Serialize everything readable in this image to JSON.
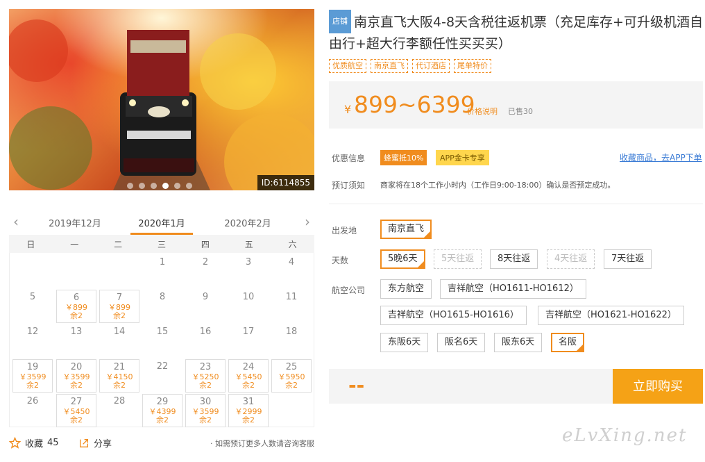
{
  "hero": {
    "id_label": "ID:6114855",
    "slide_count": 6,
    "active_slide": 4
  },
  "calendar": {
    "months": [
      "2019年12月",
      "2020年1月",
      "2020年2月"
    ],
    "weekdays": [
      "日",
      "一",
      "二",
      "三",
      "四",
      "五",
      "六"
    ],
    "days": [
      {
        "d": "1"
      },
      {
        "d": "2"
      },
      {
        "d": "3"
      },
      {
        "d": "4"
      },
      {
        "d": "5"
      },
      {
        "d": "6",
        "price": "￥899",
        "stock": "余2"
      },
      {
        "d": "7",
        "price": "￥899",
        "stock": "余2"
      },
      {
        "d": "8"
      },
      {
        "d": "9"
      },
      {
        "d": "10"
      },
      {
        "d": "11"
      },
      {
        "d": "12"
      },
      {
        "d": "13"
      },
      {
        "d": "14"
      },
      {
        "d": "15"
      },
      {
        "d": "16"
      },
      {
        "d": "17"
      },
      {
        "d": "18"
      },
      {
        "d": "19",
        "price": "￥3599",
        "stock": "余2"
      },
      {
        "d": "20",
        "price": "￥3599",
        "stock": "余2"
      },
      {
        "d": "21",
        "price": "￥4150",
        "stock": "余2"
      },
      {
        "d": "22"
      },
      {
        "d": "23",
        "price": "￥5250",
        "stock": "余2"
      },
      {
        "d": "24",
        "price": "￥5450",
        "stock": "余2"
      },
      {
        "d": "25",
        "price": "￥5950",
        "stock": "余2"
      },
      {
        "d": "26"
      },
      {
        "d": "27",
        "price": "￥5450",
        "stock": "余2"
      },
      {
        "d": "28"
      },
      {
        "d": "29",
        "price": "￥4399",
        "stock": "余2"
      },
      {
        "d": "30",
        "price": "￥3599",
        "stock": "余2"
      },
      {
        "d": "31",
        "price": "￥2999",
        "stock": "余2"
      }
    ]
  },
  "footer": {
    "favorite_label": "收藏",
    "favorite_count": "45",
    "share_label": "分享",
    "tip": "· 如需预订更多人数请咨询客服"
  },
  "product": {
    "shop_badge": "店铺",
    "title": "南京直飞大阪4-8天含税往返机票（充足库存+可升级机酒自由行+超大行李额任性买买买）",
    "tags": [
      "优质航空",
      "南京直飞",
      "代订酒店",
      "尾单特价"
    ],
    "currency": "¥",
    "price": "899~6399",
    "price_note": "价格说明",
    "sold": "已售30"
  },
  "info": {
    "promo_label": "优惠信息",
    "promo_tags": [
      "蜂蜜抵10%",
      "APP金卡专享"
    ],
    "app_link": "收藏商品，去APP下单",
    "notice_label": "预订须知",
    "notice_text": "商家将在18个工作小时内（工作日9:00-18:00）确认是否预定成功。"
  },
  "options": {
    "departure_label": "出发地",
    "departure": [
      "南京直飞"
    ],
    "days_label": "天数",
    "days": [
      "5晚6天",
      "5天往返",
      "8天往返",
      "4天往返",
      "7天往返"
    ],
    "airline_label": "航空公司",
    "airlines": [
      "东方航空",
      "吉祥航空（HO1611-HO1612）",
      "吉祥航空（HO1615-HO1616）",
      "吉祥航空（HO1621-HO1622）",
      "东阪6天",
      "阪名6天",
      "阪东6天",
      "名阪"
    ]
  },
  "buy": {
    "price_placeholder": "--",
    "button": "立即购买"
  },
  "watermark": "eLvXing.net",
  "colors": {
    "accent": "#f08c1e",
    "button": "#f5a216",
    "link": "#3a7bd5",
    "badge": "#5b9bd5"
  }
}
